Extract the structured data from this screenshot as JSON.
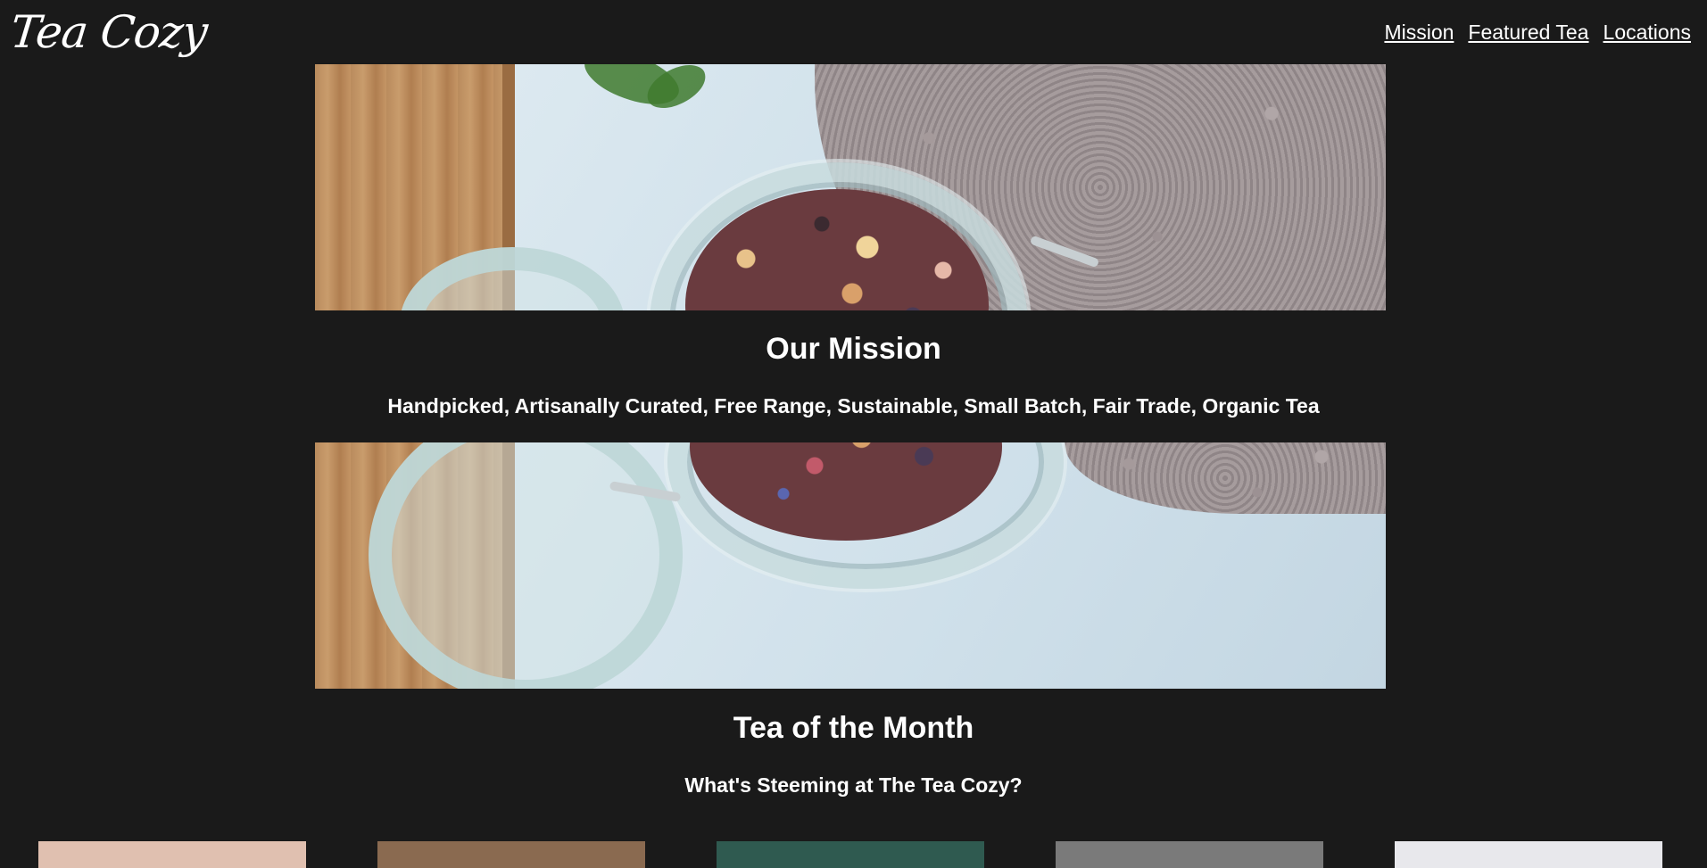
{
  "header": {
    "logo": "Tea Cozy",
    "nav": [
      {
        "label": "Mission"
      },
      {
        "label": "Featured Tea"
      },
      {
        "label": "Locations"
      }
    ]
  },
  "mission": {
    "title": "Our Mission",
    "subtitle": "Handpicked, Artisanally Curated, Free Range, Sustainable, Small Batch, Fair Trade, Organic Tea"
  },
  "featured": {
    "title": "Tea of the Month",
    "subtitle": "What's Steeming at The Tea Cozy?"
  },
  "colors": {
    "background": "#1a1a1a",
    "text": "#ffffff"
  },
  "thumbnail_colors": [
    "#e0c0b0",
    "#8a6a50",
    "#2f5a50",
    "#7a7a7a",
    "#e8e8ec"
  ]
}
